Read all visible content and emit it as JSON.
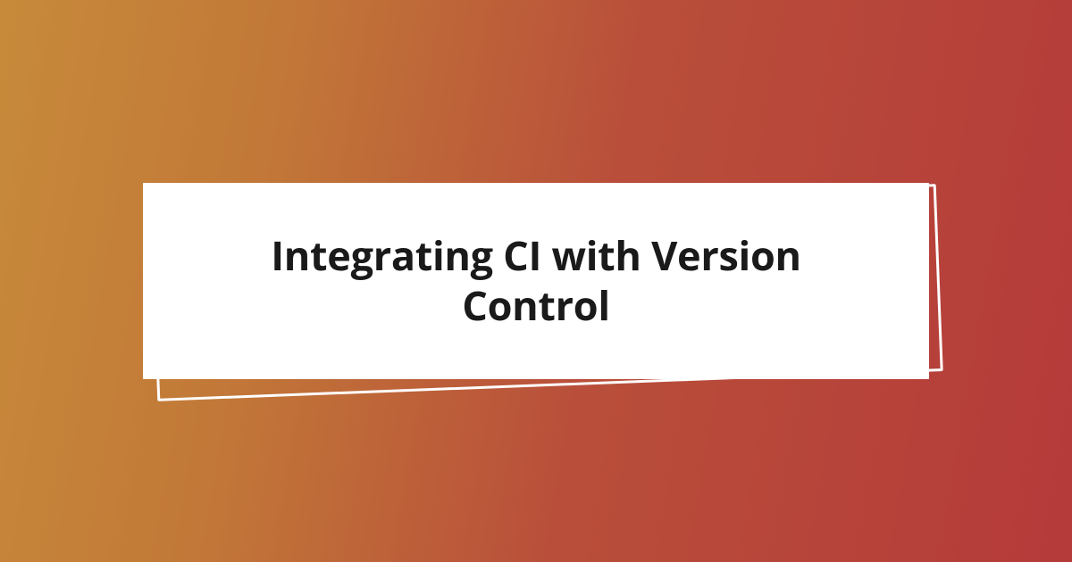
{
  "hero": {
    "title": "Integrating CI with Version Control"
  },
  "colors": {
    "gradient_start": "#c78a3a",
    "gradient_end": "#b53a3a",
    "card_bg": "#ffffff",
    "outline": "#ffffff",
    "text": "#1a1a1a"
  }
}
